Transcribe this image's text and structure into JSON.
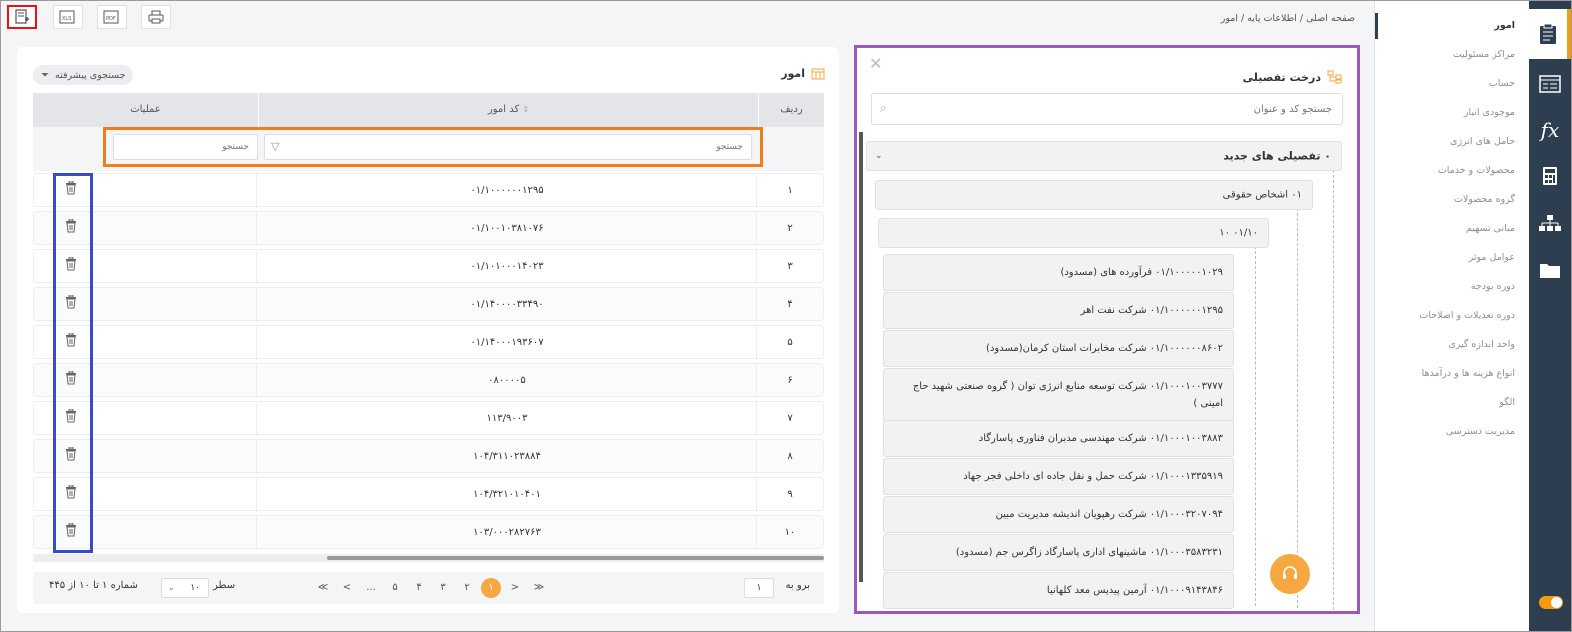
{
  "breadcrumb": "صفحه اصلی / اطلاعات پایه / امور",
  "toolbar": {
    "buttons": [
      {
        "name": "add-record-button",
        "icon": "📝"
      },
      {
        "name": "export-xls-button",
        "icon": "XLS"
      },
      {
        "name": "export-pdf-button",
        "icon": "PDF"
      },
      {
        "name": "print-button",
        "icon": "🖨"
      }
    ]
  },
  "menu": {
    "items": [
      "امور",
      "مراکز مسئولیت",
      "حساب",
      "موجودی انبار",
      "حامل های انرژی",
      "محصولات و خدمات",
      "گروه محصولات",
      "مبانی تسهیم",
      "عوامل موثر",
      "دوره بودجه",
      "دوره تعدیلات و اصلاحات",
      "واحد اندازه گیری",
      "انواع هزینه ها و درآمدها",
      "الگو",
      "مدیریت دسترسی"
    ]
  },
  "rail": {
    "icons": [
      "clipboard-icon",
      "table-icon",
      "fx-icon",
      "calculator-icon",
      "org-chart-icon",
      "folder-icon"
    ],
    "fx_label": "fx"
  },
  "tree": {
    "title": "درخت تفصیلی",
    "search_placeholder": "جستجو کد و عنوان",
    "root": "۰ تفصیلی های جدید",
    "level1": "۰۱ اشخاص حقوقی",
    "level2": "۰۱/۱۰ ۱۰",
    "leaves": [
      "۰۱/۱۰۰۰۰۰۱۰۲۹ فرآورده های (مسدود)",
      "۰۱/۱۰۰۰۰۰۰۱۲۹۵ شرکت نفت اهر",
      "۰۱/۱۰۰۰۰۰۰۸۶۰۲ شرکت مخابرات استان کرمان(مسدود)",
      "۰۱/۱۰۰۰۱۰۰۳۷۷۷ شرکت توسعه منابع انرژی توان ( گروه صنعتی شهید حاج امینی )",
      "۰۱/۱۰۰۰۱۰۰۳۸۸۳ شرکت مهندسی مدبران فناوری پاسارگاد",
      "۰۱/۱۰۰۰۱۳۳۵۹۱۹ شرکت حمل و نقل جاده ای داخلی فجر جهاد",
      "۰۱/۱۰۰۰۳۲۰۷۰۹۴ شرکت رهپویان اندیشه مدیریت مبین",
      "۰۱/۱۰۰۰۳۵۸۳۲۳۱ ماشینهای اداری پاسارگاد زاگرس جم (مسدود)",
      "۰۱/۱۰۰۰۹۱۴۳۸۴۶ آرمین پیدیس معد کلهانیا"
    ]
  },
  "grid": {
    "title": "امور",
    "advanced_search": "جستجوی پیشرفته",
    "columns": {
      "row": "ردیف",
      "code": "کد امور",
      "ops": "عملیات"
    },
    "filter_placeholder": "جستجو",
    "rows": [
      {
        "idx": "۱",
        "code": "۰۱/۱۰۰۰۰۰۰۱۲۹۵"
      },
      {
        "idx": "۲",
        "code": "۰۱/۱۰۰۱۰۳۸۱۰۷۶"
      },
      {
        "idx": "۳",
        "code": "۰۱/۱۰۱۰۰۰۱۴۰۲۳"
      },
      {
        "idx": "۴",
        "code": "۰۱/۱۴۰۰۰۰۳۳۴۹۰"
      },
      {
        "idx": "۵",
        "code": "۰۱/۱۴۰۰۰۱۹۳۶۰۷"
      },
      {
        "idx": "۶",
        "code": "۰۸۰۰۰۰۵"
      },
      {
        "idx": "۷",
        "code": "۱۱۳/۹۰۰۳"
      },
      {
        "idx": "۸",
        "code": "۱۰۴/۳۱۱۰۲۳۸۸۴"
      },
      {
        "idx": "۹",
        "code": "۱۰۴/۳۲۱۰۱۰۴۰۱"
      },
      {
        "idx": "۱۰",
        "code": "۱۰۳/۰۰۰۲۸۲۷۶۳"
      }
    ],
    "footer": {
      "goto_label": "برو به",
      "goto_value": "۱",
      "pages": [
        "≪",
        "<",
        "...",
        "۵",
        "۴",
        "۳",
        "۲",
        "۱",
        ">",
        "≫"
      ],
      "current_page": "۱",
      "rows_label": "سطر",
      "rows_value": "۱۰",
      "count": "شماره ۱ تا ۱۰ از ۴۴۵"
    }
  },
  "colors": {
    "accent": "#f5a742",
    "rail": "#2c3e50",
    "tree_border": "#9b59b6",
    "filter_border": "#f07c1b",
    "ops_border": "#3a4bc9",
    "toolbar_highlight": "#ee1111"
  }
}
